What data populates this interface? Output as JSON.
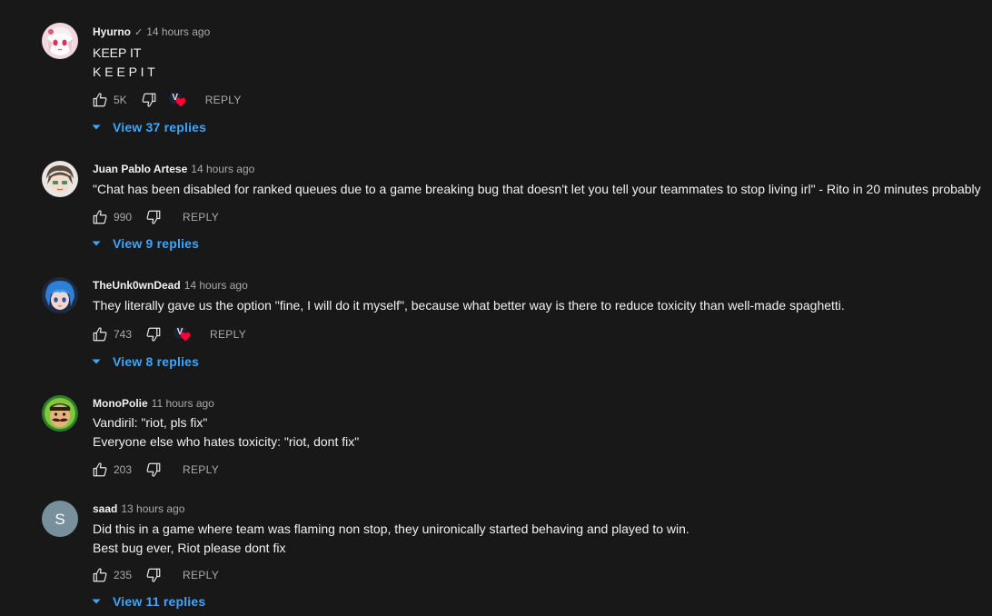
{
  "comments": [
    {
      "author": "Hyurno",
      "verified": true,
      "time": "14 hours ago",
      "lines": [
        "KEEP IT",
        "K E E P I T"
      ],
      "likes": "5K",
      "creator_heart": true,
      "creator_initial": "V",
      "reply_label": "REPLY",
      "view_replies": "View 37 replies",
      "avatar_icon": "anime-girl-avatar"
    },
    {
      "author": "Juan Pablo Artese",
      "verified": false,
      "time": "14 hours ago",
      "lines": [
        "\"Chat has been disabled for ranked queues due to a game breaking bug that doesn't let you tell your teammates to stop living irl\" - Rito in 20 minutes probably"
      ],
      "likes": "990",
      "creator_heart": false,
      "reply_label": "REPLY",
      "view_replies": "View 9 replies",
      "avatar_icon": "anime-boy-avatar"
    },
    {
      "author": "TheUnk0wnDead",
      "verified": false,
      "time": "14 hours ago",
      "lines": [
        "They literally gave us the option \"fine, I will do it myself\", because what better way is there to reduce toxicity than well-made spaghetti."
      ],
      "likes": "743",
      "creator_heart": true,
      "creator_initial": "V",
      "reply_label": "REPLY",
      "view_replies": "View 8 replies",
      "avatar_icon": "blue-hair-avatar"
    },
    {
      "author": "MonoPolie",
      "verified": false,
      "time": "11 hours ago",
      "lines": [
        "Vandiril: \"riot, pls fix\"",
        "Everyone else who hates toxicity: \"riot, dont fix\""
      ],
      "likes": "203",
      "creator_heart": false,
      "reply_label": "REPLY",
      "avatar_icon": "mustache-man-avatar"
    },
    {
      "author": "saad",
      "verified": false,
      "time": "13 hours ago",
      "lines": [
        "Did this in a game where team was flaming non stop, they unironically started behaving and played to win.",
        "Best bug ever, Riot please dont fix"
      ],
      "likes": "235",
      "creator_heart": false,
      "reply_label": "REPLY",
      "view_replies": "View 11 replies",
      "avatar_letter": "S",
      "avatar_icon": "letter-avatar"
    }
  ],
  "colors": {
    "background": "#181818",
    "text": "#f1f1f1",
    "secondary": "#aaaaaa",
    "link": "#3ea6ff",
    "heart": "#ff0033"
  }
}
